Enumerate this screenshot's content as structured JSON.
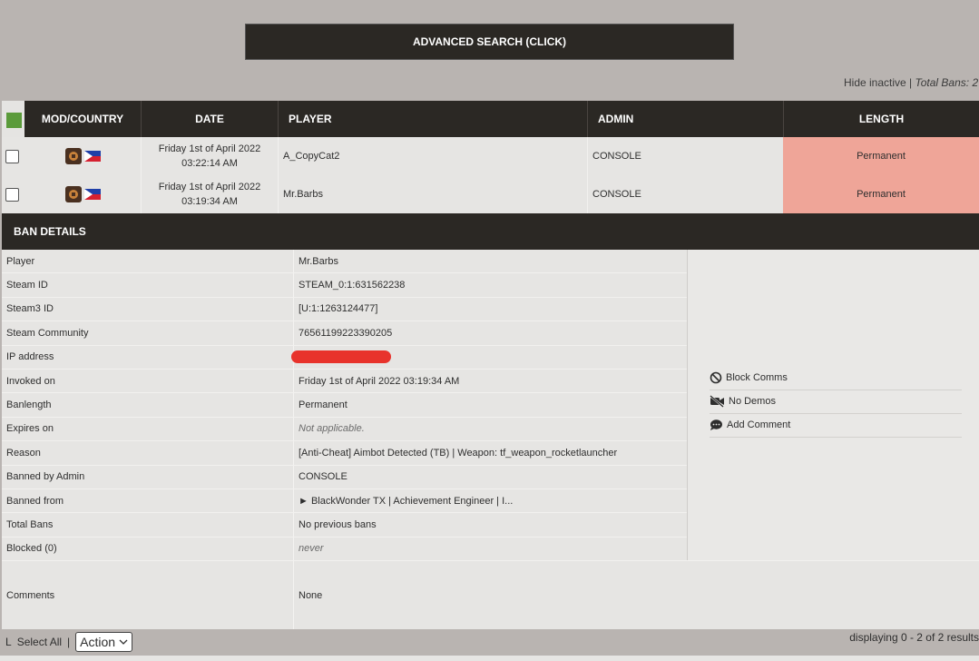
{
  "advanced_search_label": "ADVANCED SEARCH (CLICK)",
  "top_info": {
    "hide_inactive": "Hide inactive",
    "separator": "|",
    "total_bans": "Total Bans: 2"
  },
  "table": {
    "headers": [
      "MOD/COUNTRY",
      "DATE",
      "PLAYER",
      "ADMIN",
      "LENGTH"
    ],
    "rows": [
      {
        "date_line1": "Friday 1st of April 2022",
        "date_line2": "03:22:14 AM",
        "player": "A_CopyCat2",
        "admin": "CONSOLE",
        "length": "Permanent"
      },
      {
        "date_line1": "Friday 1st of April 2022",
        "date_line2": "03:19:34 AM",
        "player": "Mr.Barbs",
        "admin": "CONSOLE",
        "length": "Permanent"
      }
    ]
  },
  "ban_details": {
    "title": "BAN DETAILS",
    "rows": [
      {
        "label": "Player",
        "value": "Mr.Barbs"
      },
      {
        "label": "Steam ID",
        "value": "STEAM_0:1:631562238"
      },
      {
        "label": "Steam3 ID",
        "value": "[U:1:1263124477]"
      },
      {
        "label": "Steam Community",
        "value": "76561199223390205"
      },
      {
        "label": "IP address",
        "value": ""
      },
      {
        "label": "Invoked on",
        "value": "Friday 1st of April 2022 03:19:34 AM"
      },
      {
        "label": "Banlength",
        "value": "Permanent"
      },
      {
        "label": "Expires on",
        "value": "Not applicable."
      },
      {
        "label": "Reason",
        "value": "[Anti-Cheat] Aimbot Detected (TB) | Weapon: tf_weapon_rocketlauncher"
      },
      {
        "label": "Banned by Admin",
        "value": "CONSOLE"
      },
      {
        "label": "Banned from",
        "value": "► BlackWonder TX | Achievement Engineer | I..."
      },
      {
        "label": "Total Bans",
        "value": "No previous bans"
      },
      {
        "label": "Blocked (0)",
        "value": "never"
      }
    ],
    "comments": {
      "label": "Comments",
      "value": "None"
    },
    "actions": [
      "Block Comms",
      "No Demos",
      "Add Comment"
    ]
  },
  "footer": {
    "l_label": "L",
    "select_all": "Select All",
    "separator": "|",
    "action_select": "Action",
    "results": "displaying 0 - 2 of 2 results"
  },
  "colors": {
    "header_bg": "#2b2824",
    "permanent_bg": "#efa598",
    "redaction": "#e8332c",
    "page_bg": "#b9b4b1"
  }
}
